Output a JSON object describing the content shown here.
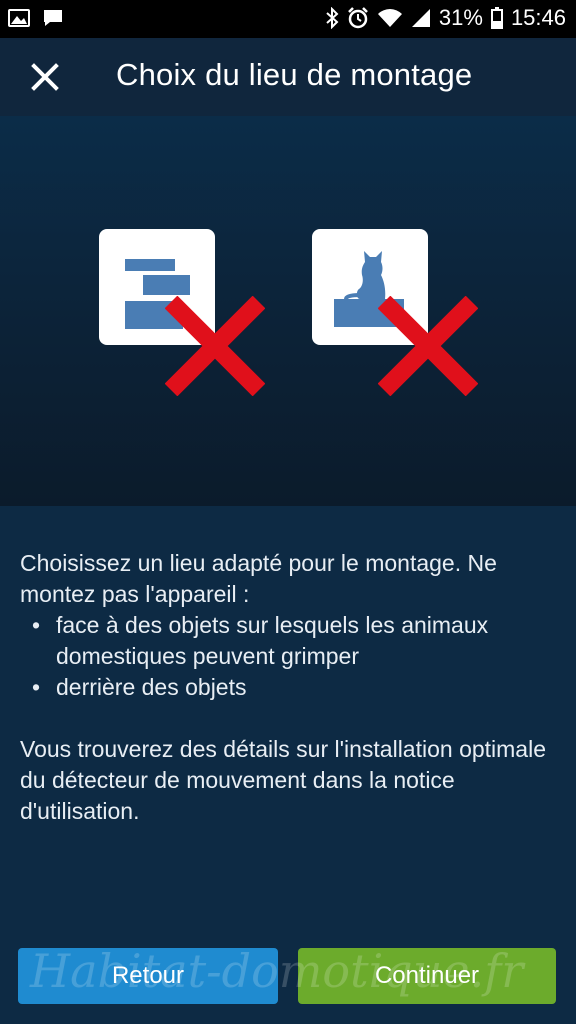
{
  "status_bar": {
    "battery": "31%",
    "time": "15:46",
    "icons": [
      "image-icon",
      "message-icon",
      "bluetooth-icon",
      "alarm-icon",
      "wifi-icon",
      "signal-icon",
      "battery-icon"
    ]
  },
  "header": {
    "title": "Choix du lieu de montage",
    "close_icon": "close-icon"
  },
  "illustration": {
    "left_card_icon": "shelves-icon",
    "right_card_icon": "cat-icon",
    "mark_icon": "red-x-icon",
    "mark_color": "#e0101b"
  },
  "content": {
    "intro": "Choisissez un lieu adapté pour le montage. Ne montez pas l'appareil :",
    "bullets": [
      "face à des objets sur lesquels les animaux domestiques peuvent grimper",
      "derrière des objets"
    ],
    "details": "Vous trouverez des détails sur l'installation optimale du détecteur de mouvement dans la notice d'utilisation."
  },
  "buttons": {
    "back_label": "Retour",
    "back_color": "#1f8bd0",
    "next_label": "Continuer",
    "next_color": "#6cab2c"
  },
  "watermark": "Habitat-domotique.fr"
}
